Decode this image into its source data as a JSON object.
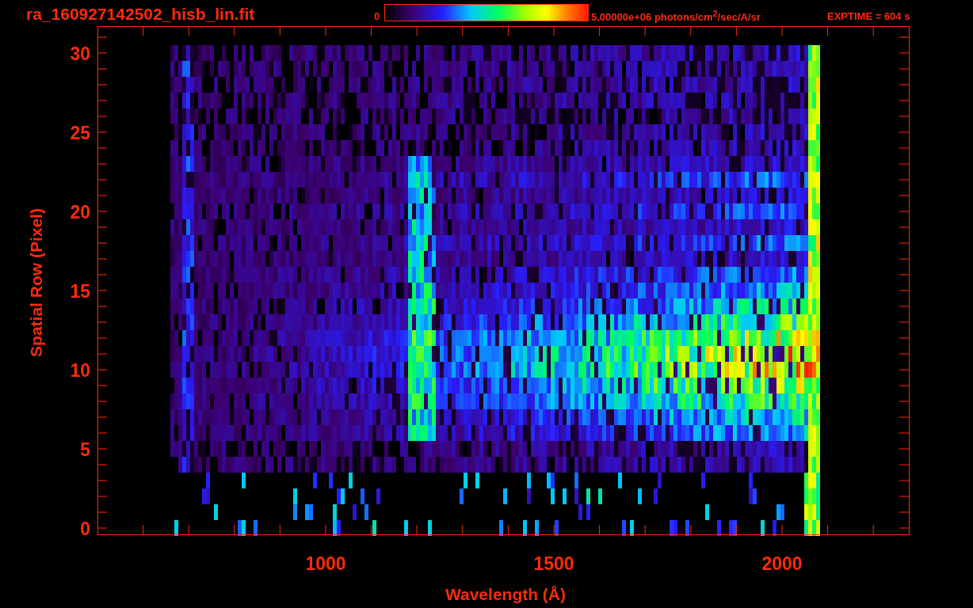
{
  "title": "ra_160927142502_hisb_lin.fit",
  "colorbar": {
    "min_label": "0",
    "max_label": "5.00000e+06 photons/cm$^{2}$/sec/A/sr"
  },
  "exposure": "EXPTIME = 604 s",
  "y_axis": {
    "label": "Spatial Row (Pixel)",
    "ticks": [
      "30",
      "25",
      "20",
      "15",
      "10",
      "5",
      "0"
    ]
  },
  "x_axis": {
    "label": "Wavelength (Å)",
    "ticks": [
      "1000",
      "1500",
      "2000"
    ]
  }
}
